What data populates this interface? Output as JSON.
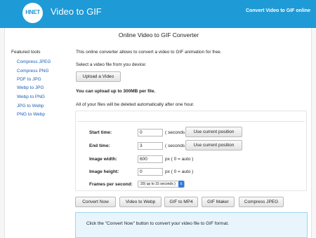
{
  "header": {
    "logo_text": "HNET",
    "app_title": "Video to GIF",
    "link": "Convert Video to GIF online",
    "color": "#1e9ad6"
  },
  "page": {
    "title": "Online Video to GIF Converter"
  },
  "sidebar": {
    "heading": "Featured tools",
    "links": [
      "Compress JPEG",
      "Compress PNG",
      "PDF to JPG",
      "Webp to JPG",
      "Webp to PNG",
      "JPG to Webp",
      "PNG to Webp"
    ]
  },
  "intro": {
    "description": "This online converter allows to convert a video to GIF animation for free.",
    "select_prompt": "Select a video file from you device:",
    "upload_button": "Upload a Video",
    "size_limit": "You can upload up to 300MB per file.",
    "deletion_note": "All of your files will be deleted automatically after one hour."
  },
  "form": {
    "start_time": {
      "label": "Start time:",
      "value": "0",
      "unit": "( seconds )",
      "button": "Use current position"
    },
    "end_time": {
      "label": "End time:",
      "value": "3",
      "unit": "( seconds )",
      "button": "Use current position"
    },
    "image_width": {
      "label": "Image width:",
      "value": "600",
      "unit": "px ( 0 = auto )"
    },
    "image_height": {
      "label": "Image height:",
      "value": "0",
      "unit": "px ( 0 = auto )"
    },
    "fps": {
      "label": "Frames per second:",
      "selected": "20( up to 15 seconds )"
    }
  },
  "actions": [
    "Convert Now",
    "Video to Webp",
    "GIF to MP4",
    "GIF Maker",
    "Compress JPEG"
  ],
  "note": "Click the \"Convert Now\" button to convert your video file to GIF format.",
  "colors": {
    "link": "#1a5fb4",
    "note_bg": "#e8f5fc",
    "note_border": "#9fd3ee"
  }
}
